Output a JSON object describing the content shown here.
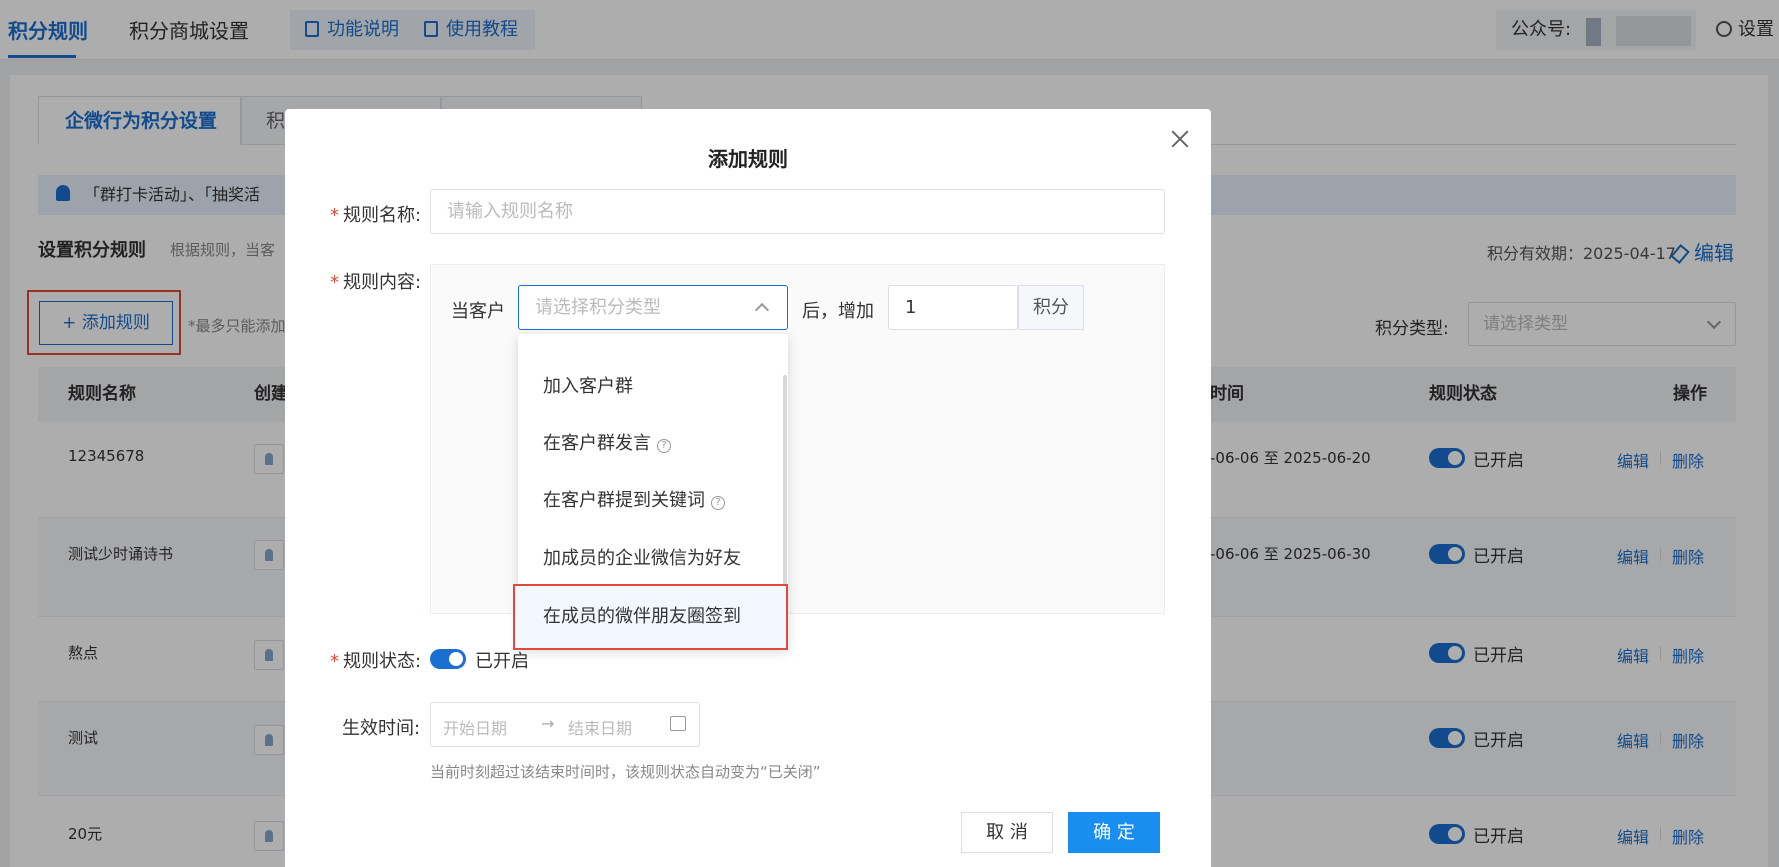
{
  "topnav": {
    "tabs": [
      "积分规则",
      "积分商城设置"
    ],
    "help_buttons": [
      "功能说明",
      "使用教程"
    ],
    "account_label": "公众号:",
    "settings_label": "设置"
  },
  "page": {
    "subtabs": [
      "企微行为积分设置",
      "积"
    ],
    "notice": "「群打卡活动」、「抽奖活",
    "rules_title": "设置积分规则",
    "rules_desc": "根据规则，当客",
    "validity": "积分有效期：2025-04-17",
    "edit_label": "编辑",
    "add_button": "+ 添加规则",
    "max_note": "*最多只能添加",
    "points_type_label": "积分类型:",
    "points_type_placeholder": "请选择类型"
  },
  "table": {
    "headers": [
      "规则名称",
      "创建",
      "时间",
      "规则状态",
      "操作"
    ],
    "rows": [
      {
        "name": "12345678",
        "time": "-06-06 至 2025-06-20",
        "status": "已开启"
      },
      {
        "name": "测试少时诵诗书",
        "time": "-06-06 至 2025-06-30",
        "status": "已开启"
      },
      {
        "name": "熬点",
        "time": "",
        "status": "已开启"
      },
      {
        "name": "测试",
        "time": "",
        "status": "已开启"
      },
      {
        "name": "20元",
        "time": "",
        "status": "已开启"
      }
    ],
    "op_edit": "编辑",
    "op_delete": "删除"
  },
  "modal": {
    "title": "添加规则",
    "name_label": "规则名称:",
    "name_placeholder": "请输入规则名称",
    "content_label": "规则内容:",
    "when_customer": "当客户",
    "type_placeholder": "请选择积分类型",
    "after_add": "后，增加",
    "points_value": "1",
    "points_unit": "积分",
    "dropdown_options": [
      "加入客户群",
      "在客户群发言",
      "在客户群提到关键词",
      "加成员的企业微信为好友",
      "在成员的微伴朋友圈签到"
    ],
    "status_label": "规则状态:",
    "status_value": "已开启",
    "time_label": "生效时间:",
    "start_placeholder": "开始日期",
    "end_placeholder": "结束日期",
    "arrow": "→",
    "hint": "当前时刻超过该结束时间时，该规则状态自动变为“已关闭”",
    "cancel": "取 消",
    "confirm": "确 定"
  }
}
